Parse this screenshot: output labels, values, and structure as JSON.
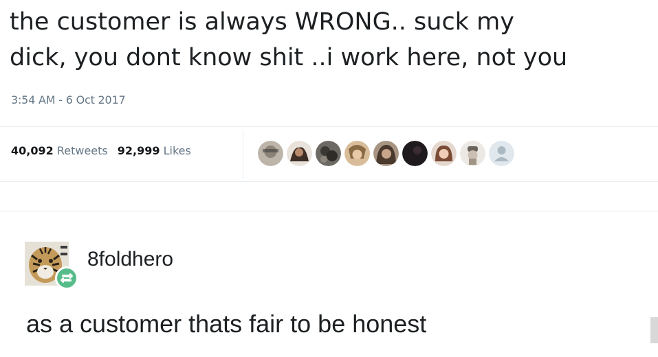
{
  "tweet": {
    "text_line1": "the customer is always WRONG.. suck my",
    "text_line2": "dick, you dont know shit ..i work here, not you",
    "timestamp": "3:54 AM - 6 Oct 2017",
    "retweets_count": "40,092",
    "retweets_label": "Retweets",
    "likes_count": "92,999",
    "likes_label": "Likes",
    "liker_avatars": [
      {
        "icon": "avatar-1",
        "color": "#b9b2a6"
      },
      {
        "icon": "avatar-2",
        "color": "#5a4637"
      },
      {
        "icon": "avatar-3",
        "color": "#4e4a44"
      },
      {
        "icon": "avatar-4",
        "color": "#c7a27a"
      },
      {
        "icon": "avatar-5",
        "color": "#8f7a67"
      },
      {
        "icon": "avatar-6",
        "color": "#1e1a1c"
      },
      {
        "icon": "avatar-7",
        "color": "#9a6a52"
      },
      {
        "icon": "avatar-8",
        "color": "#c8c2ba"
      },
      {
        "icon": "avatar-default",
        "color": "#c5cdd3"
      }
    ]
  },
  "reblog": {
    "username": "8foldhero",
    "avatar_icon": "tiger-avatar",
    "badge_icon": "reblog-icon",
    "badge_color": "#56bc8a",
    "comment": "as a customer thats fair to be honest"
  }
}
